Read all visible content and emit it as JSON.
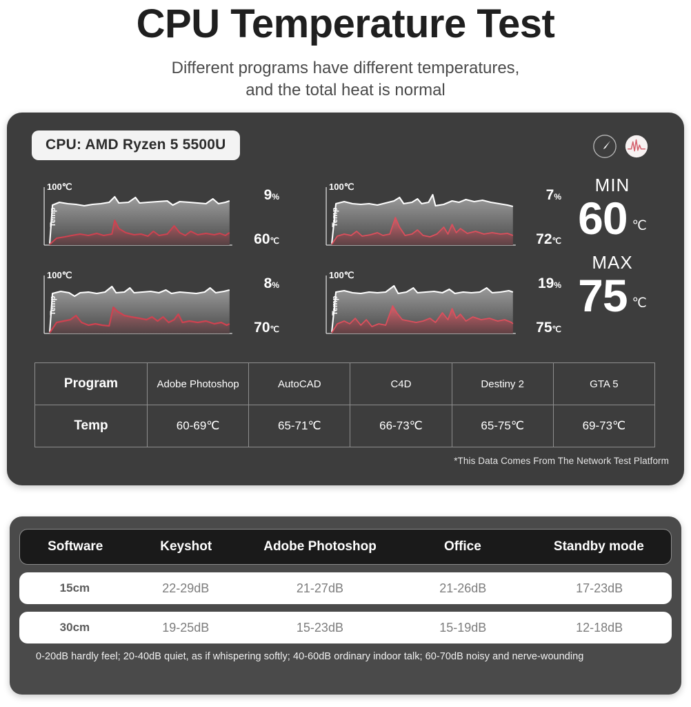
{
  "header": {
    "title": "CPU Temperature Test",
    "subtitle_line1": "Different programs have different temperatures,",
    "subtitle_line2": "and the total heat is normal"
  },
  "panel": {
    "cpu_label": "CPU: AMD Ryzen 5 5500U",
    "icons": [
      {
        "name": "gauge-icon",
        "label": "gauge"
      },
      {
        "name": "pulse-waveform-icon",
        "label": "pulse"
      }
    ],
    "charts": [
      {
        "axis_max_label": "100℃",
        "y_axis_label": "Temp",
        "percent": "9",
        "percent_unit": "%",
        "temp": "60",
        "temp_unit": "℃"
      },
      {
        "axis_max_label": "100℃",
        "y_axis_label": "Temp",
        "percent": "7",
        "percent_unit": "%",
        "temp": "72",
        "temp_unit": "℃"
      },
      {
        "axis_max_label": "100℃",
        "y_axis_label": "Temp",
        "percent": "8",
        "percent_unit": "%",
        "temp": "70",
        "temp_unit": "℃"
      },
      {
        "axis_max_label": "100℃",
        "y_axis_label": "Temp",
        "percent": "19",
        "percent_unit": "%",
        "temp": "75",
        "temp_unit": "℃"
      }
    ],
    "min": {
      "label": "MIN",
      "value": "60",
      "unit": "℃"
    },
    "max": {
      "label": "MAX",
      "value": "75",
      "unit": "℃"
    },
    "program_table": {
      "row_headers": [
        "Program",
        "Temp"
      ],
      "programs": [
        "Adobe Photoshop",
        "AutoCAD",
        "C4D",
        "Destiny 2",
        "GTA 5"
      ],
      "temps": [
        "60-69℃",
        "65-71℃",
        "66-73℃",
        "65-75℃",
        "69-73℃"
      ]
    },
    "footnote": "*This Data Comes From The Network Test Platform"
  },
  "noise": {
    "headers": [
      "Software",
      "Keyshot",
      "Adobe Photoshop",
      "Office",
      "Standby mode"
    ],
    "rows": [
      {
        "distance": "15cm",
        "values": [
          "22-29dB",
          "21-27dB",
          "21-26dB",
          "17-23dB"
        ]
      },
      {
        "distance": "30cm",
        "values": [
          "19-25dB",
          "15-23dB",
          "15-19dB",
          "12-18dB"
        ]
      }
    ],
    "footnote": "0-20dB hardly feel; 20-40dB quiet, as if whispering softly; 40-60dB ordinary indoor talk; 60-70dB noisy and nerve-wounding"
  },
  "chart_data": {
    "type": "area",
    "title": "CPU Temperature Test",
    "ylabel": "Temp",
    "ylim": [
      0,
      100
    ],
    "grid": false,
    "legend": "none",
    "series": [
      {
        "name": "Adobe Photoshop",
        "cpu_usage_percent": 9,
        "temperature_c": 60,
        "temp_white_line": [
          12,
          72,
          74,
          73,
          73,
          72,
          71,
          72,
          73,
          76,
          72,
          72,
          73,
          74,
          72,
          72,
          71,
          72,
          74,
          72,
          73,
          71,
          72,
          74,
          72,
          71,
          70,
          72,
          73,
          72
        ],
        "usage_red_line": [
          2,
          6,
          8,
          7,
          9,
          12,
          10,
          8,
          9,
          34,
          14,
          10,
          12,
          15,
          11,
          9,
          18,
          12,
          24,
          14,
          11,
          16,
          13,
          12,
          14,
          11,
          10,
          12,
          13,
          11
        ]
      },
      {
        "name": "AutoCAD",
        "cpu_usage_percent": 7,
        "temperature_c": 72,
        "temp_white_line": [
          12,
          74,
          76,
          74,
          73,
          73,
          74,
          73,
          76,
          74,
          73,
          74,
          78,
          68,
          70,
          72,
          73,
          74,
          73,
          74,
          75,
          74,
          73,
          72,
          71,
          70,
          69,
          70,
          69,
          68
        ],
        "usage_red_line": [
          2,
          10,
          12,
          10,
          13,
          16,
          12,
          11,
          13,
          30,
          14,
          12,
          22,
          12,
          10,
          14,
          18,
          20,
          28,
          16,
          26,
          18,
          14,
          16,
          15,
          14,
          16,
          15,
          13,
          12
        ]
      },
      {
        "name": "C4D",
        "cpu_usage_percent": 8,
        "temperature_c": 70,
        "temp_white_line": [
          12,
          73,
          75,
          74,
          73,
          72,
          73,
          72,
          76,
          73,
          74,
          73,
          72,
          73,
          74,
          73,
          75,
          73,
          74,
          72,
          73,
          72,
          73,
          74,
          73,
          72,
          71,
          73,
          74,
          73
        ],
        "usage_red_line": [
          2,
          12,
          14,
          13,
          18,
          14,
          12,
          11,
          14,
          38,
          32,
          28,
          26,
          24,
          22,
          24,
          22,
          20,
          26,
          21,
          18,
          20,
          19,
          18,
          17,
          16,
          15,
          14,
          16,
          15
        ]
      },
      {
        "name": "Destiny 2 / GTA 5",
        "cpu_usage_percent": 19,
        "temperature_c": 75,
        "temp_white_line": [
          12,
          74,
          76,
          75,
          74,
          73,
          74,
          73,
          78,
          74,
          76,
          74,
          75,
          74,
          73,
          74,
          76,
          74,
          75,
          73,
          74,
          73,
          74,
          75,
          74,
          73,
          74,
          75,
          74,
          73
        ],
        "usage_red_line": [
          2,
          12,
          16,
          14,
          20,
          16,
          22,
          14,
          40,
          30,
          24,
          22,
          20,
          22,
          21,
          26,
          32,
          24,
          30,
          22,
          24,
          23,
          22,
          21,
          22,
          20,
          19,
          20,
          19,
          18
        ]
      }
    ]
  }
}
